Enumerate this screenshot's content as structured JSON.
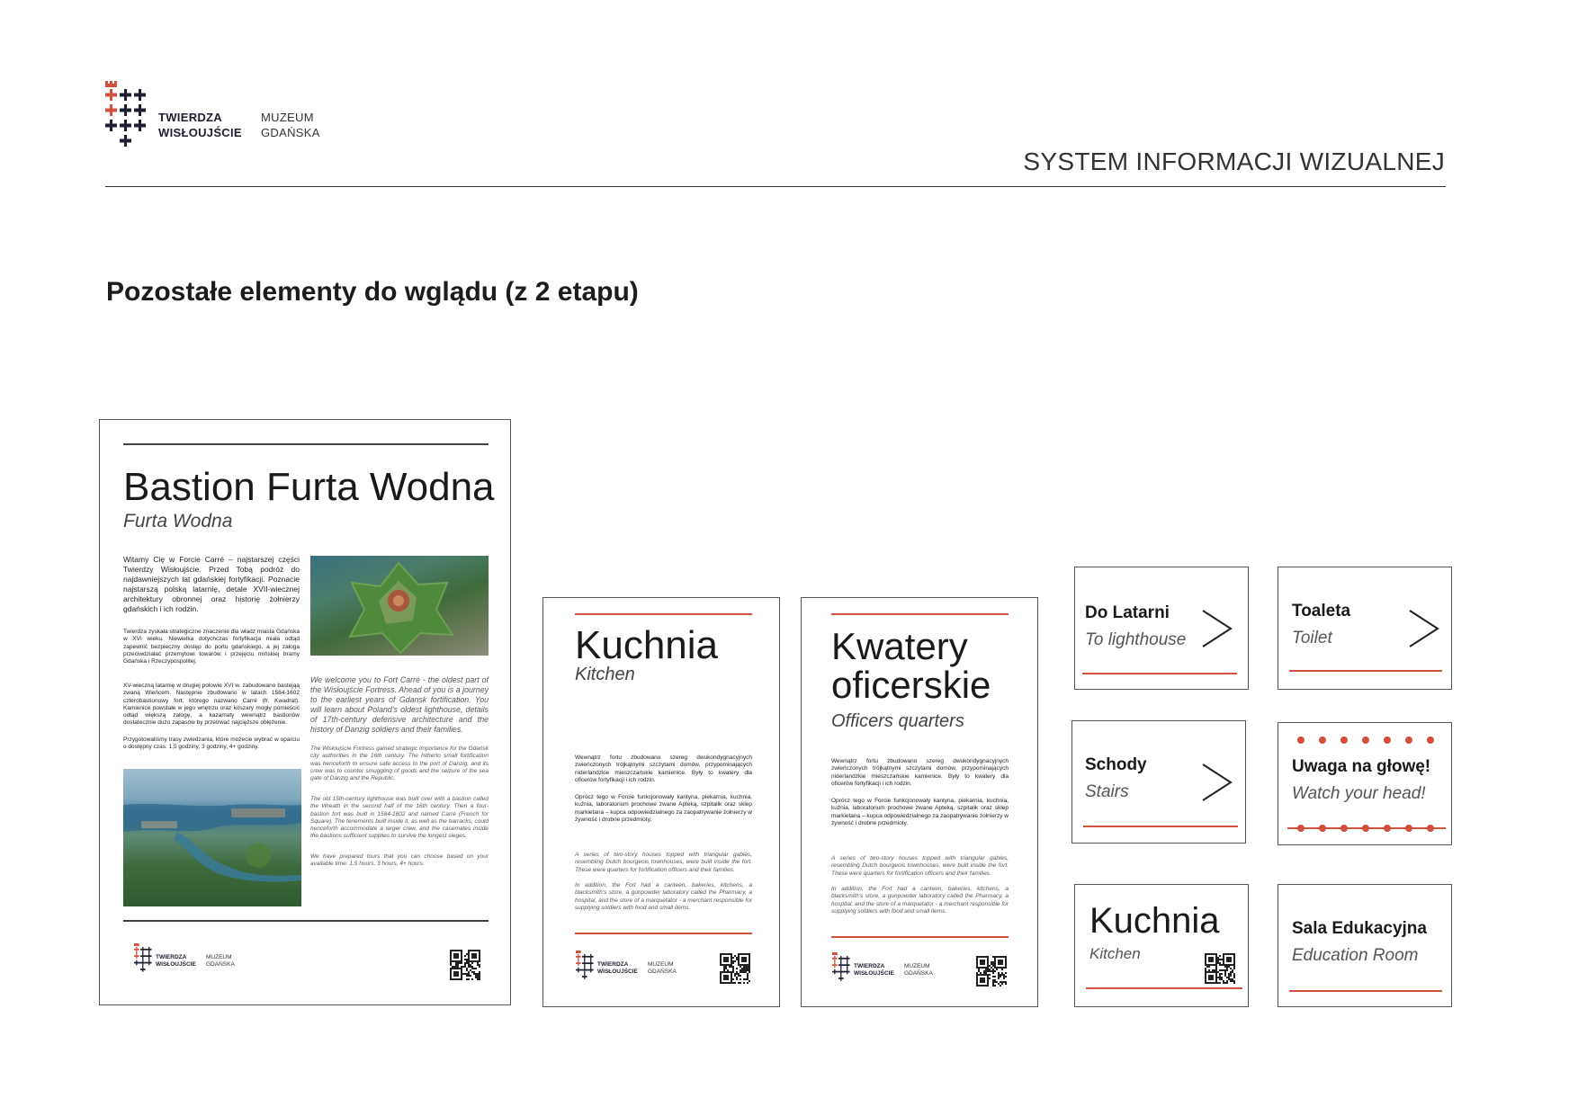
{
  "header": {
    "logo_name_line1": "TWIERDZA",
    "logo_name_line2": "WISŁOUJŚCIE",
    "logo_museum_line1": "MUZEUM",
    "logo_museum_line2": "GDAŃSKA",
    "system_title": "SYSTEM INFORMACJI WIZUALNEJ"
  },
  "section_title": "Pozostałe elementy do wglądu (z 2 etapu)",
  "colors": {
    "accent_red": "#d2503c",
    "navy": "#1e1f2e"
  },
  "board_bastion": {
    "title": "Bastion Furta Wodna",
    "subtitle": "Furta Wodna",
    "intro_pl": "Witamy Cię w Forcie Carré – najstarszej części Twierdzy Wisłoujście. Przed Tobą podróż do najdawniejszych lat gdańskiej fortyfikacji. Poznacie najstarszą polską latarnię, detale XVII-wiecznej architektury obronnej oraz historię żołnierzy gdańskich i ich rodzin.",
    "body_pl_1": "Twierdza zyskała strategiczne znaczenie dla władz miasta Gdańska w XVI wieku. Niewielka dotychczas fortyfikacja miała odtąd zapewnić bezpieczny dostęp do portu gdańskiego, a jej załoga przeciwdziałać przemytowi towarów i przejęciu mińskiej bramy Gdańska i Rzeczypospolitej.",
    "body_pl_2": "XV-wieczną latarnię w drugiej połowie XVI w. zabudowano bastejąą zwaną Wieńcem. Następnie zbudowano w latach 1584-1602 czterobastionowy fort, którego nazwano Carré (fr. Kwadrat). Kamienice powstałe w jego wnętrzu oraz koszary mogły pomieścić odtąd większą załogę, a kazamaty wewnątrz bastionów dostatecznie dużo zapasów by przetrwać najcięższe oblężenie.",
    "body_pl_3": "Przygotowaliśmy trasy zwiedzania, które możecie wybrać w oparciu o dostępny czas: 1,5 godziny, 3 godziny, 4+ godziny.",
    "intro_en": "We welcome you to Fort Carré - the oldest part of the Wisłoujście Fortress. Ahead of you is a journey to the earliest years of Gdansk fortification. You will learn about Poland's oldest lighthouse, details of 17th-century defensive architecture and the history of Danzig soldiers and their families.",
    "body_en_1": "The Wisłoujście Fortress gained strategic importance for the Gdańsk city authorities in the 16th century. The hitherto small fortification was henceforth to ensure safe access to the port of Danzig, and its crew was to counter smuggling of goods and the seizure of the sea gate of Danzig and the Republic.",
    "body_en_2": "The old 15th-century lighthouse was built over with a bastion called the Wreath in the second half of the 16th century. Then a four-bastion fort was built in 1584-1602 and named Carré (French for Square). The tenements built inside it, as well as the barracks, could henceforth accommodate a larger crew, and the casemates inside the bastions sufficient supplies to survive the longest sieges.",
    "body_en_3": "We have prepared tours that you can choose based on your available time: 1.5 hours, 3 hours, 4+ hours."
  },
  "board_kitchen": {
    "title": "Kuchnia",
    "subtitle": "Kitchen",
    "body_pl_1": "Wewnątrz fortu zbudowano szereg dwukondygnacyjnych zwieńczonych trójkątnymi szczytami domów, przypominających niderlandzkie mieszczańskie kamienice. Były to kwatery dla oficerów fortyfikacji i ich rodzin.",
    "body_pl_2": "Oprócz tego w Forcie funkcjonowały kantyna, piekarnia, kuchnia, kuźnia, laboratorium prochowe zwane Apteką, szpitalik oraz sklep markietana – kupca odpowiedzialnego za zaopatrywanie żołnierzy w żywność i drobne przedmioty.",
    "body_en_1": "A series of two-story houses topped with triangular gables, resembling Dutch bourgeois townhouses, were built inside the fort. These were quarters for fortification officers and their families.",
    "body_en_2": "In addition, the Fort had a canteen, bakeries, kitchens, a blacksmith's store, a gunpowder laboratory called the Pharmacy, a hospital, and the store of a marquetator - a merchant responsible for supplying soldiers with food and small items."
  },
  "board_officers": {
    "title_line1": "Kwatery",
    "title_line2": "oficerskie",
    "subtitle": "Officers quarters"
  },
  "signs": {
    "lighthouse": {
      "title": "Do Latarni",
      "subtitle": "To lighthouse"
    },
    "toilet": {
      "title": "Toaleta",
      "subtitle": "Toilet"
    },
    "stairs": {
      "title": "Schody",
      "subtitle": "Stairs"
    },
    "head": {
      "title": "Uwaga na głowę!",
      "subtitle": "Watch your head!"
    },
    "kitchen": {
      "title": "Kuchnia",
      "subtitle": "Kitchen"
    },
    "education": {
      "title": "Sala Edukacyjna",
      "subtitle": "Education Room"
    }
  }
}
